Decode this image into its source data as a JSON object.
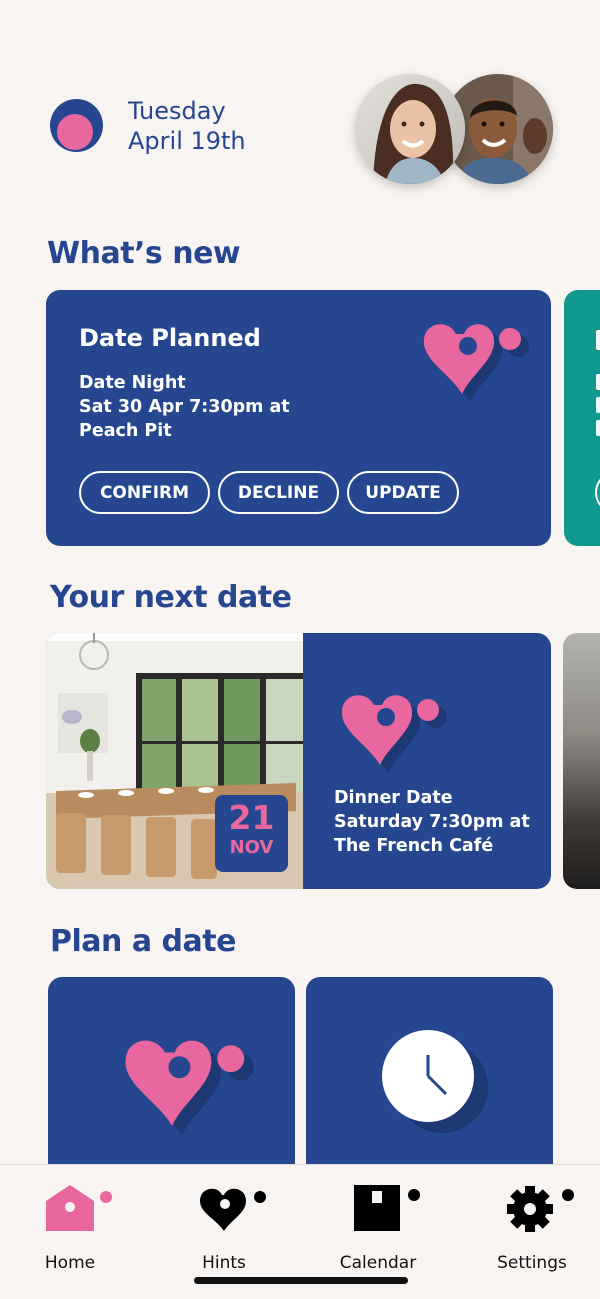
{
  "header": {
    "weekday": "Tuesday",
    "date": "April 19th"
  },
  "whats_new": {
    "title": "What’s new",
    "card": {
      "title": "Date Planned",
      "lines": [
        "Date Night",
        "Sat 30 Apr 7:30pm at",
        "Peach Pit"
      ],
      "buttons": {
        "confirm": "CONFIRM",
        "decline": "DECLINE",
        "update": "UPDATE"
      }
    }
  },
  "next_date": {
    "title": "Your next date",
    "badge": {
      "day": "21",
      "month": "NOV"
    },
    "lines": [
      "Dinner Date",
      "Saturday 7:30pm at",
      "The French Café"
    ]
  },
  "plan_date": {
    "title": "Plan a date",
    "cards": [
      {
        "icon": "heart-location-icon"
      },
      {
        "icon": "clock-icon"
      }
    ]
  },
  "tabbar": {
    "items": [
      {
        "label": "Home",
        "icon": "home-icon",
        "active": true
      },
      {
        "label": "Hints",
        "icon": "heart-icon",
        "active": false
      },
      {
        "label": "Calendar",
        "icon": "calendar-icon",
        "active": false
      },
      {
        "label": "Settings",
        "icon": "gear-icon",
        "active": false
      }
    ]
  },
  "colors": {
    "primary": "#26478f",
    "accent": "#e8679f",
    "teal": "#11988f",
    "background": "#f8f4f2"
  }
}
